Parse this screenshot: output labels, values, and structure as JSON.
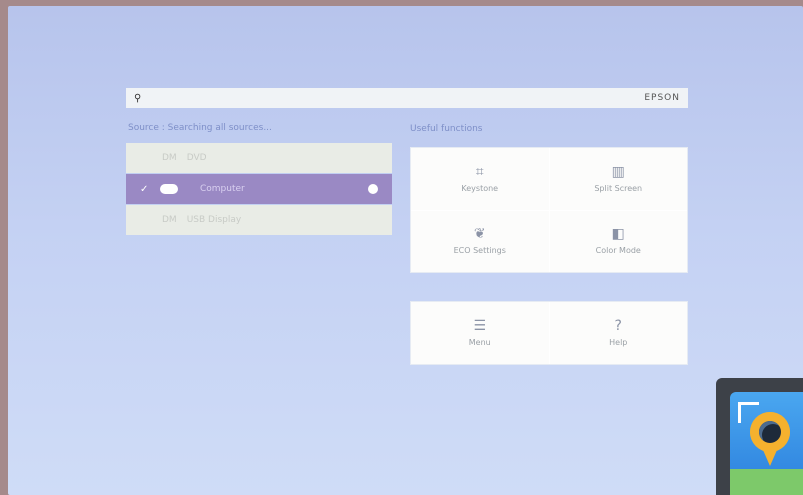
{
  "topbar": {
    "search_icon": "search-icon",
    "brand": "EPSON"
  },
  "sources": {
    "header": "Source : Searching all sources...",
    "items": [
      {
        "tag": "DM",
        "label": "DVD",
        "selected": false
      },
      {
        "tag": "",
        "label": "Computer",
        "selected": true
      },
      {
        "tag": "DM",
        "label": "USB Display",
        "selected": false
      }
    ]
  },
  "useful": {
    "header": "Useful functions",
    "functions": [
      {
        "icon": "keystone-icon",
        "glyph": "⌗",
        "label": "Keystone"
      },
      {
        "icon": "split-screen-icon",
        "glyph": "▥",
        "label": "Split Screen"
      },
      {
        "icon": "eco-icon",
        "glyph": "❦",
        "label": "ECO Settings"
      },
      {
        "icon": "color-mode-icon",
        "glyph": "◧",
        "label": "Color Mode"
      }
    ]
  },
  "bottom": {
    "items": [
      {
        "icon": "menu-icon",
        "glyph": "☰",
        "label": "Menu"
      },
      {
        "icon": "help-icon",
        "glyph": "?",
        "label": "Help"
      }
    ]
  },
  "colors": {
    "background": "#b7c4ec",
    "accent": "#9a89c4",
    "panel": "#fcfcfb"
  }
}
